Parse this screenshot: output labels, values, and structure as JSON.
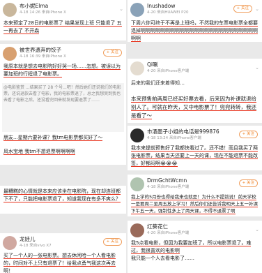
{
  "posts": [
    {
      "name": "布小妮Elma",
      "vip": "",
      "meta": "4-18 14:26 来自iPhone X",
      "follow": "",
      "text_a": "本来预定了28日的电影票了 结果发现上班 只能退了 五一再去了 不开森",
      "text_b": ""
    },
    {
      "name": "Inushadow",
      "vip": "",
      "meta": "4-20 来自HUAWEI P20",
      "follow": "+ 关注",
      "text_a": "下周六你可终于不再是上班吗，不然我的车票电影票全都要退掉啊啊啊啊啊啊啊啊啊啊啊啊啊啊啊啊啊啊啊啊啊啊啊啊啊啊",
      "text_b": ""
    },
    {
      "name": "被世界遗弃的饺子",
      "vip": "",
      "meta": "4-18 16:39 来自iPhone X",
      "follow": "+ 关注",
      "text_a": "我原本就是想去电影院好好哭一场……怎想。被误以为要加班的行程退了电影票。",
      "text_b": "@电影鉴赏 ...结果买了 28 个号...吧！然后她们还说我们的电影票，还说退款去看了电影，我的电影票退了，总之我想哭到我也去看了电影之后，还没看完回来就发现要退票了……"
    },
    {
      "name": "Qi唰",
      "vip": "",
      "meta": "4-20 来自iPhone客户端",
      "follow": "",
      "text_a": "后来的我们还来着得知…",
      "text_b": ""
    },
    {
      "name": "",
      "vip": "",
      "meta": "",
      "follow": "",
      "text_a": "本来预售前两周已经买好票去看，后来因为补课就退给别人了。可就在昨天，又中电影票了！兜兜转转，我还是看了～",
      "text_b": ""
    },
    {
      "name": "市酒墨子小姐的电话是999876",
      "vip": "",
      "meta": "4-18 13:24 来自iPhone客户端",
      "follow": "+ 关注",
      "text_a": "我本来提前预售好了我都快看过了。还不错！而且我买了两张电影票，结果当天还要上一天的课，现在不能退票不能改签，好郁闷啊😭😭😭",
      "text_b": ""
    },
    {
      "name": "",
      "vip": "",
      "meta": "",
      "follow": "",
      "text_a": "朋友...星期六要补课？我tm电影票都买好了～",
      "text_b": "风水宝地 我tm不想退票啊啊啊啊"
    },
    {
      "name": "",
      "vip": "",
      "meta": "",
      "follow": "",
      "text_a": "最糟糕的心情就是本来应该坐在电影院，现在却连班都下不了，只能把电影票退了，知道我现在有多不爽么？",
      "text_b": ""
    },
    {
      "name": "DrmGchtWcmn",
      "vip": "",
      "meta": "4-18 来自iPhone客户端",
      "follow": "+ 关注",
      "text_a": "我上学的5月份也得给我来也就是！为什么不提前说！前天学校一是要周二至周五放上学习！然后你们还告诉我明天上五一补课下午五一天，强制性多上了两天课，不得不退票了啊",
      "text_b": ""
    },
    {
      "name": "龙娃儿",
      "vip": "",
      "meta": "4-18 来自vivo X7",
      "follow": "+ 关注",
      "text_a": "买了一个人的一张电影票。想去休闲哈一个人看电影的，时间对不上只有退票了！给我点勇气我这次再去啊！",
      "text_b": ""
    },
    {
      "name": "红葵花仁",
      "vip": "",
      "meta": "4-20 来自iPhone客户端",
      "follow": "",
      "text_a": "我5点看电影，但因为我要加班了，所以电影票退了。难过，我很喜欢的电影啊",
      "text_b": "我只能一个人去看电影了……"
    }
  ],
  "icons": {
    "repost": "↗",
    "comment": "▢",
    "like": "♡",
    "follow": "+关注"
  },
  "accent_red": "#e8321c",
  "follow_orange": "#f08020"
}
